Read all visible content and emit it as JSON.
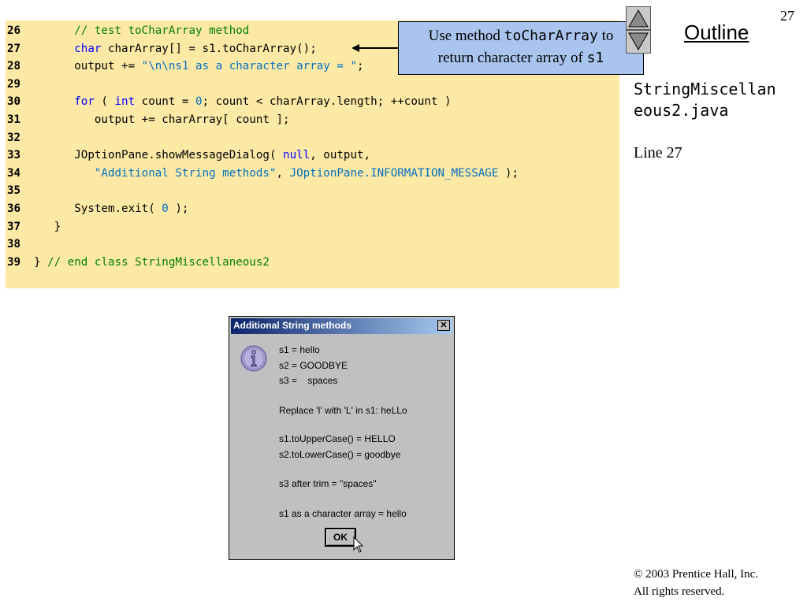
{
  "slide": {
    "page_number": "27",
    "outline_title": "Outline",
    "filename_line1": "StringMiscellan",
    "filename_line2": "eous2.java",
    "line_ref": "Line 27",
    "copyright_line1": "© 2003 Prentice Hall, Inc.",
    "copyright_line2": "All rights reserved."
  },
  "callout": {
    "text1": "Use method ",
    "code1": "toCharArray",
    "text2": " to",
    "text3": "return character array of ",
    "code2": "s1"
  },
  "code": {
    "colors": {
      "keyword": "#0000ff",
      "comment": "#008000",
      "string": "#0070c0",
      "background": "#fde9a6"
    },
    "lines": [
      {
        "num": "26",
        "segments": [
          {
            "t": "      ",
            "c": ""
          },
          {
            "t": "// test toCharArray method",
            "c": "cm"
          }
        ]
      },
      {
        "num": "27",
        "segments": [
          {
            "t": "      ",
            "c": ""
          },
          {
            "t": "char",
            "c": "kw"
          },
          {
            "t": " charArray[] = s1.toCharArray();",
            "c": ""
          }
        ]
      },
      {
        "num": "28",
        "segments": [
          {
            "t": "      output += ",
            "c": ""
          },
          {
            "t": "\"\\n\\ns1 as a character array = \"",
            "c": "st"
          },
          {
            "t": ";",
            "c": ""
          }
        ]
      },
      {
        "num": "29",
        "segments": []
      },
      {
        "num": "30",
        "segments": [
          {
            "t": "      ",
            "c": ""
          },
          {
            "t": "for",
            "c": "kw"
          },
          {
            "t": " ( ",
            "c": ""
          },
          {
            "t": "int",
            "c": "kw"
          },
          {
            "t": " count = ",
            "c": ""
          },
          {
            "t": "0",
            "c": "nm"
          },
          {
            "t": "; count < charArray.length; ++count )",
            "c": ""
          }
        ]
      },
      {
        "num": "31",
        "segments": [
          {
            "t": "         output += charArray[ count ];",
            "c": ""
          }
        ]
      },
      {
        "num": "32",
        "segments": []
      },
      {
        "num": "33",
        "segments": [
          {
            "t": "      JOptionPane.showMessageDialog( ",
            "c": ""
          },
          {
            "t": "null",
            "c": "kw"
          },
          {
            "t": ", output,",
            "c": ""
          }
        ]
      },
      {
        "num": "34",
        "segments": [
          {
            "t": "         ",
            "c": ""
          },
          {
            "t": "\"Additional String methods\"",
            "c": "st"
          },
          {
            "t": ", ",
            "c": ""
          },
          {
            "t": "JOptionPane.INFORMATION_MESSAGE",
            "c": "st"
          },
          {
            "t": " );",
            "c": ""
          }
        ]
      },
      {
        "num": "35",
        "segments": []
      },
      {
        "num": "36",
        "segments": [
          {
            "t": "      System.exit( ",
            "c": ""
          },
          {
            "t": "0",
            "c": "nm"
          },
          {
            "t": " );",
            "c": ""
          }
        ]
      },
      {
        "num": "37",
        "segments": [
          {
            "t": "   }",
            "c": ""
          }
        ]
      },
      {
        "num": "38",
        "segments": []
      },
      {
        "num": "39",
        "segments": [
          {
            "t": "} ",
            "c": ""
          },
          {
            "t": "// end class StringMiscellaneous2",
            "c": "cm"
          }
        ]
      }
    ]
  },
  "dialog": {
    "title": "Additional String methods",
    "close_glyph": "✕",
    "icon": "info-icon",
    "lines": [
      "s1 = hello",
      "s2 = GOODBYE",
      "s3 =    spaces",
      "Replace 'l' with 'L' in s1: heLLo",
      "s1.toUpperCase() = HELLO",
      "s2.toLowerCase() = goodbye",
      "s3 after trim = \"spaces\"",
      "s1 as a character array = hello"
    ],
    "ok_label": "OK"
  }
}
